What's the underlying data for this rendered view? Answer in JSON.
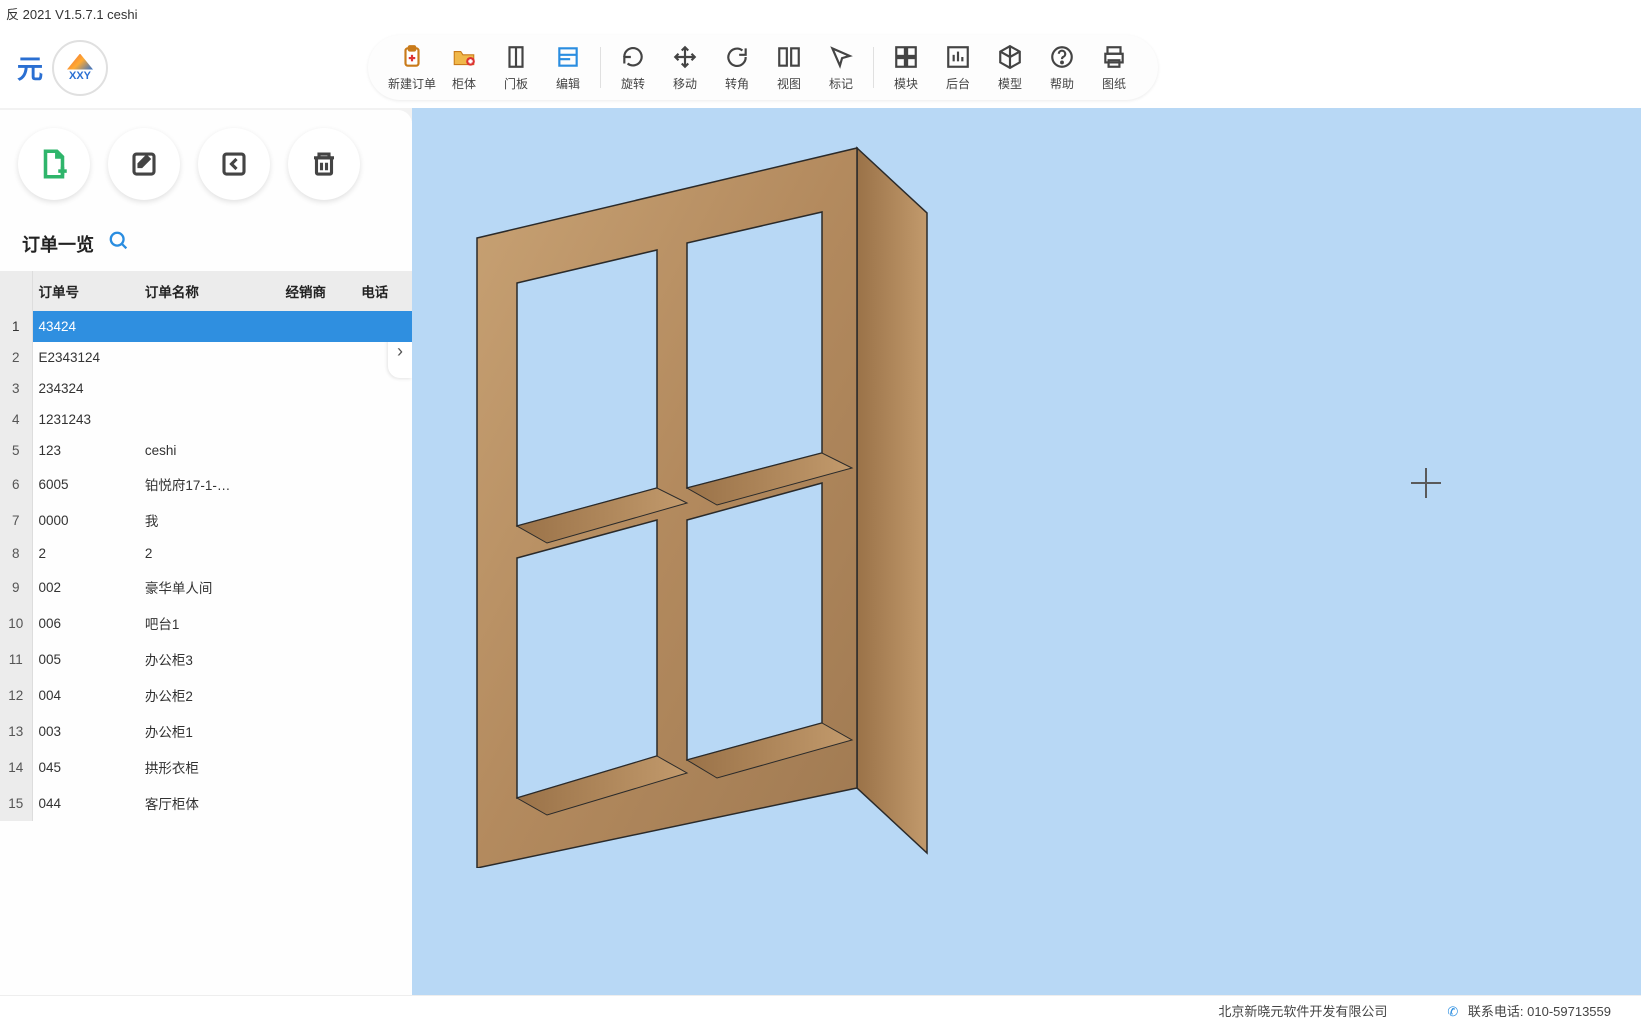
{
  "window": {
    "title": "反 2021 V1.5.7.1 ceshi"
  },
  "logo": {
    "short": "元",
    "code": "XXY"
  },
  "toolbar": [
    [
      {
        "id": "new-order",
        "label": "新建订单",
        "icon": "clipboard-plus"
      },
      {
        "id": "cabinet",
        "label": "柜体",
        "icon": "folder-plus"
      },
      {
        "id": "door",
        "label": "门板",
        "icon": "door"
      },
      {
        "id": "edit",
        "label": "编辑",
        "icon": "edit-box"
      }
    ],
    [
      {
        "id": "rotate",
        "label": "旋转",
        "icon": "rotate"
      },
      {
        "id": "move",
        "label": "移动",
        "icon": "move"
      },
      {
        "id": "corner",
        "label": "转角",
        "icon": "refresh"
      },
      {
        "id": "view",
        "label": "视图",
        "icon": "view-cols"
      },
      {
        "id": "mark",
        "label": "标记",
        "icon": "cursor"
      }
    ],
    [
      {
        "id": "module",
        "label": "模块",
        "icon": "grid"
      },
      {
        "id": "backstage",
        "label": "后台",
        "icon": "chart"
      },
      {
        "id": "model",
        "label": "模型",
        "icon": "cube"
      },
      {
        "id": "help",
        "label": "帮助",
        "icon": "help"
      },
      {
        "id": "drawing",
        "label": "图纸",
        "icon": "printer"
      }
    ]
  ],
  "sidebar": {
    "title": "订单一览",
    "actions": [
      {
        "id": "add",
        "icon": "doc-plus",
        "accent": "#2fb56b"
      },
      {
        "id": "edit",
        "icon": "edit",
        "accent": "#444"
      },
      {
        "id": "import",
        "icon": "import",
        "accent": "#444"
      },
      {
        "id": "delete",
        "icon": "trash",
        "accent": "#444"
      }
    ],
    "columns": [
      "订单号",
      "订单名称",
      "经销商",
      "电话"
    ],
    "rows": [
      {
        "n": 1,
        "order": "43424",
        "name": "",
        "dealer": "",
        "phone": "",
        "selected": true
      },
      {
        "n": 2,
        "order": "E2343124",
        "name": "",
        "dealer": "",
        "phone": ""
      },
      {
        "n": 3,
        "order": "234324",
        "name": "",
        "dealer": "",
        "phone": ""
      },
      {
        "n": 4,
        "order": "1231243",
        "name": "",
        "dealer": "",
        "phone": ""
      },
      {
        "n": 5,
        "order": "123",
        "name": "ceshi",
        "dealer": "",
        "phone": ""
      },
      {
        "n": 6,
        "order": "6005",
        "name": "铂悦府17-1-…",
        "dealer": "",
        "phone": ""
      },
      {
        "n": 7,
        "order": "0000",
        "name": "我",
        "dealer": "",
        "phone": ""
      },
      {
        "n": 8,
        "order": "2",
        "name": "2",
        "dealer": "",
        "phone": ""
      },
      {
        "n": 9,
        "order": "002",
        "name": "豪华单人间",
        "dealer": "",
        "phone": ""
      },
      {
        "n": 10,
        "order": "006",
        "name": "吧台1",
        "dealer": "",
        "phone": ""
      },
      {
        "n": 11,
        "order": "005",
        "name": "办公柜3",
        "dealer": "",
        "phone": ""
      },
      {
        "n": 12,
        "order": "004",
        "name": "办公柜2",
        "dealer": "",
        "phone": ""
      },
      {
        "n": 13,
        "order": "003",
        "name": "办公柜1",
        "dealer": "",
        "phone": ""
      },
      {
        "n": 14,
        "order": "045",
        "name": "拱形衣柜",
        "dealer": "",
        "phone": ""
      },
      {
        "n": 15,
        "order": "044",
        "name": "客厅柜体",
        "dealer": "",
        "phone": ""
      }
    ]
  },
  "status": {
    "company": "北京新晓元软件开发有限公司",
    "phone_label": "联系电话: 010-59713559"
  }
}
